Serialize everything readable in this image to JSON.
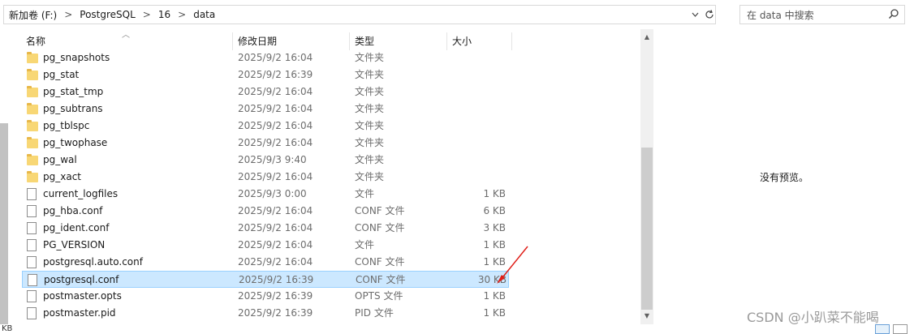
{
  "address": {
    "crumbs": [
      "新加卷 (F:)",
      "PostgreSQL",
      "16",
      "data"
    ],
    "separator": ">"
  },
  "search": {
    "placeholder": "在 data 中搜索"
  },
  "columns": {
    "name": "名称",
    "date": "修改日期",
    "type": "类型",
    "size": "大小"
  },
  "files": [
    {
      "name": "pg_snapshots",
      "date": "2025/9/2 16:04",
      "type": "文件夹",
      "size": "",
      "kind": "folder"
    },
    {
      "name": "pg_stat",
      "date": "2025/9/2 16:39",
      "type": "文件夹",
      "size": "",
      "kind": "folder"
    },
    {
      "name": "pg_stat_tmp",
      "date": "2025/9/2 16:04",
      "type": "文件夹",
      "size": "",
      "kind": "folder"
    },
    {
      "name": "pg_subtrans",
      "date": "2025/9/2 16:04",
      "type": "文件夹",
      "size": "",
      "kind": "folder"
    },
    {
      "name": "pg_tblspc",
      "date": "2025/9/2 16:04",
      "type": "文件夹",
      "size": "",
      "kind": "folder"
    },
    {
      "name": "pg_twophase",
      "date": "2025/9/2 16:04",
      "type": "文件夹",
      "size": "",
      "kind": "folder"
    },
    {
      "name": "pg_wal",
      "date": "2025/9/3 9:40",
      "type": "文件夹",
      "size": "",
      "kind": "folder"
    },
    {
      "name": "pg_xact",
      "date": "2025/9/2 16:04",
      "type": "文件夹",
      "size": "",
      "kind": "folder"
    },
    {
      "name": "current_logfiles",
      "date": "2025/9/3 0:00",
      "type": "文件",
      "size": "1 KB",
      "kind": "file"
    },
    {
      "name": "pg_hba.conf",
      "date": "2025/9/2 16:04",
      "type": "CONF 文件",
      "size": "6 KB",
      "kind": "file"
    },
    {
      "name": "pg_ident.conf",
      "date": "2025/9/2 16:04",
      "type": "CONF 文件",
      "size": "3 KB",
      "kind": "file"
    },
    {
      "name": "PG_VERSION",
      "date": "2025/9/2 16:04",
      "type": "文件",
      "size": "1 KB",
      "kind": "file"
    },
    {
      "name": "postgresql.auto.conf",
      "date": "2025/9/2 16:04",
      "type": "CONF 文件",
      "size": "1 KB",
      "kind": "file"
    },
    {
      "name": "postgresql.conf",
      "date": "2025/9/2 16:39",
      "type": "CONF 文件",
      "size": "30 KB",
      "kind": "file",
      "selected": true
    },
    {
      "name": "postmaster.opts",
      "date": "2025/9/2 16:39",
      "type": "OPTS 文件",
      "size": "1 KB",
      "kind": "file"
    },
    {
      "name": "postmaster.pid",
      "date": "2025/9/2 16:39",
      "type": "PID 文件",
      "size": "1 KB",
      "kind": "file"
    }
  ],
  "preview": {
    "message": "没有预览。"
  },
  "watermark": "CSDN @小趴菜不能喝",
  "status": {
    "partial": "KB"
  },
  "colors": {
    "selected_bg": "#cce8ff",
    "selected_border": "#99d1ff",
    "folder": "#f8d775",
    "annotation_arrow": "#e0201a"
  },
  "icons": {
    "folder": "folder-icon",
    "file": "file-icon",
    "search": "search-icon",
    "refresh": "refresh-icon",
    "dropdown": "chevron-down-icon"
  }
}
